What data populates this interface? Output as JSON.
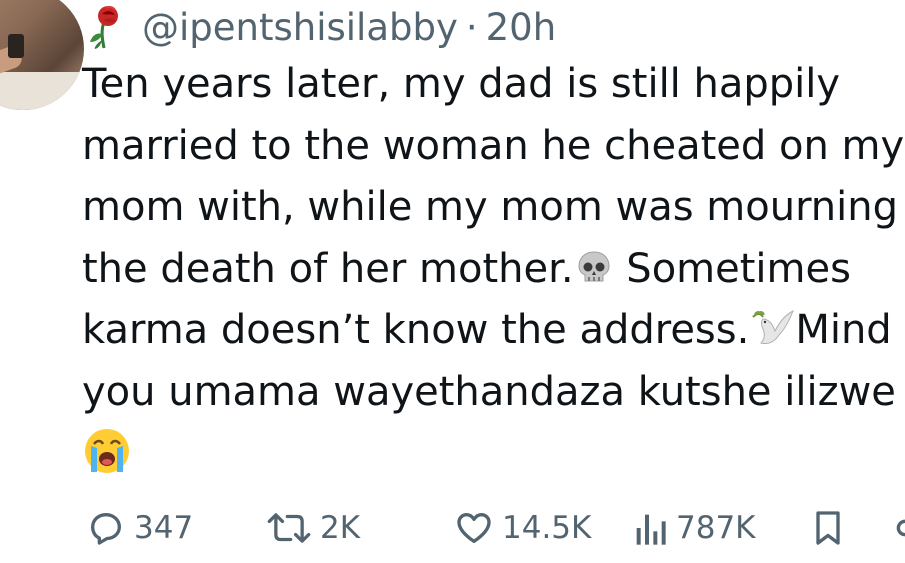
{
  "tweet": {
    "handle": "@ipentshisilabby",
    "separator": "·",
    "time": "20h",
    "author_emoji": "rose-icon",
    "lines": [
      "Ten years later, my dad is still happily",
      "married to the woman he cheated on my",
      "mom with, while my mom was mourning",
      "the death of her mother.",
      " Sometimes",
      "karma doesn’t know the address.",
      "Mind",
      "you umama wayethandaza kutshe ilizwe"
    ],
    "emojis": [
      "skull-icon",
      "dove-icon",
      "crying-face-icon"
    ]
  },
  "actions": {
    "reply_count": "347",
    "retweet_count": "2K",
    "like_count": "14.5K",
    "views_count": "787K"
  },
  "colors": {
    "text": "#0f1419",
    "secondary": "#536471",
    "background": "#ffffff"
  }
}
